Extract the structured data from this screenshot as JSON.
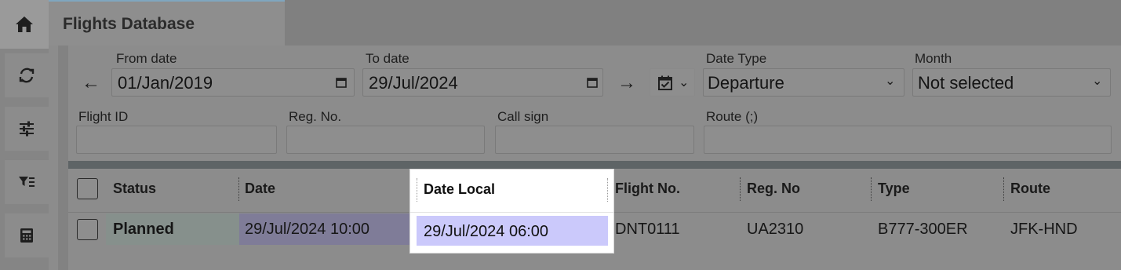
{
  "tab": {
    "title": "Flights Database"
  },
  "sidebar": {
    "items": [
      {
        "icon": "home-icon"
      },
      {
        "icon": "refresh-icon"
      },
      {
        "icon": "sliders-icon"
      },
      {
        "icon": "filter-list-icon"
      },
      {
        "icon": "calculator-icon"
      }
    ]
  },
  "filters": {
    "from_date": {
      "label": "From date",
      "value": "01/Jan/2019"
    },
    "to_date": {
      "label": "To date",
      "value": "29/Jul/2024"
    },
    "date_type": {
      "label": "Date Type",
      "value": "Departure"
    },
    "month": {
      "label": "Month",
      "value": "Not selected"
    },
    "flight_id": {
      "label": "Flight ID",
      "value": ""
    },
    "reg_no": {
      "label": "Reg. No.",
      "value": ""
    },
    "call_sign": {
      "label": "Call sign",
      "value": ""
    },
    "route": {
      "label": "Route (;)",
      "value": ""
    },
    "prev_arrow": "←",
    "next_arrow": "→"
  },
  "table": {
    "columns": [
      "Status",
      "Date",
      "Date Local",
      "Flight No.",
      "Reg. No",
      "Type",
      "Route"
    ],
    "rows": [
      {
        "status": "Planned",
        "date": "29/Jul/2024 10:00",
        "date_local": "29/Jul/2024 06:00",
        "flight_no": "DNT0111",
        "reg_no": "UA2310",
        "type": "B777-300ER",
        "route": "JFK-HND"
      }
    ]
  },
  "colors": {
    "overlay_gray": "#8a8a8a",
    "highlight_purple": "#cbc9fb",
    "divider": "#5e6466"
  }
}
